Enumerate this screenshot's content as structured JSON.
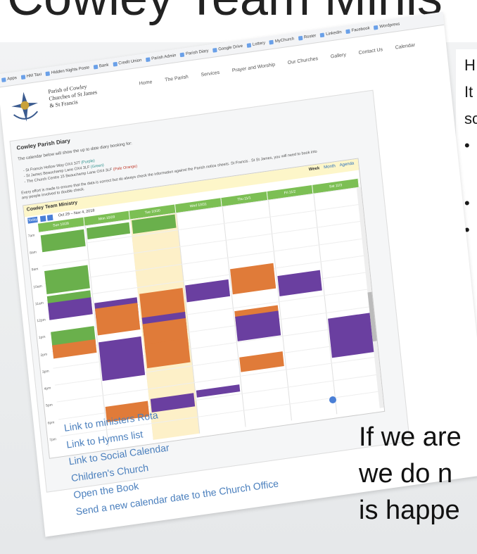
{
  "slide": {
    "title_partial": "Cowley Team Minis",
    "right_partial_lines": [
      "H",
      "It",
      "sc"
    ],
    "bottom_partial_lines": [
      "If we are",
      "we do n",
      "is happe"
    ]
  },
  "browser": {
    "bookmarks": [
      "Apps",
      "HM Taxi",
      "Hidden Nights Poste",
      "Bank",
      "Credit Union",
      "Parish Admin",
      "Parish Diary",
      "Google Drive",
      "Lottery",
      "MyChurch",
      "Roster",
      "LinkedIn",
      "Facebook",
      "Wordpress"
    ]
  },
  "site": {
    "parish_name": [
      "Parish of Cowley",
      "Churches of St James",
      "& St Francis"
    ],
    "nav": [
      "Home",
      "The Parish",
      "Services",
      "Prayer and Worship",
      "Our Churches",
      "Gallery",
      "Contact Us",
      "Calendar"
    ]
  },
  "diary": {
    "title": "Cowley Parish Diary",
    "intro": "The calendar below will show the up to date diary booking for:",
    "bullets": [
      {
        "text": "St Francis Hollow Way OX4 3JT",
        "tag": "(Purple)"
      },
      {
        "text": "St James Beauchamp Lane OX4 3LF",
        "tag": "(Green)"
      },
      {
        "text": "The Church Centre 15 Beauchamp Lane OX4 3LF",
        "tag": "(Pale Orange)"
      }
    ],
    "effort_text": "Every effort is made to ensure that the data is correct but do always check the information against the Parish notice sheets. St Francis . St St James, you will need to book into any people involved to double check.",
    "calendar": {
      "title": "Cowley Team Ministry",
      "today_label": "Today",
      "range": "Oct 29 – Nov 4, 2018",
      "views": [
        "Week",
        "Month",
        "Agenda"
      ],
      "active_view": "Week",
      "days": [
        "Sun 10/28",
        "Mon 10/29",
        "Tue 10/30",
        "Wed 10/31",
        "Thu 11/1",
        "Fri 11/2",
        "Sat 11/3"
      ],
      "times": [
        "7am",
        "8am",
        "9am",
        "10am",
        "11am",
        "12pm",
        "1pm",
        "2pm",
        "3pm",
        "4pm",
        "5pm",
        "6pm",
        "7pm"
      ]
    }
  },
  "links": [
    "Link to ministers Rota",
    "Link to Hymns list",
    "Link to Social Calendar",
    "Children's Church",
    "Open the Book",
    "Send a new calendar date to the Church Office"
  ],
  "colors": {
    "link": "#4a7fbd",
    "event_green": "#6ab04c",
    "event_orange": "#e07b39",
    "event_purple": "#6a3fa0",
    "today_column": "#fdf0c8",
    "calendar_header": "#fdf6c9"
  }
}
